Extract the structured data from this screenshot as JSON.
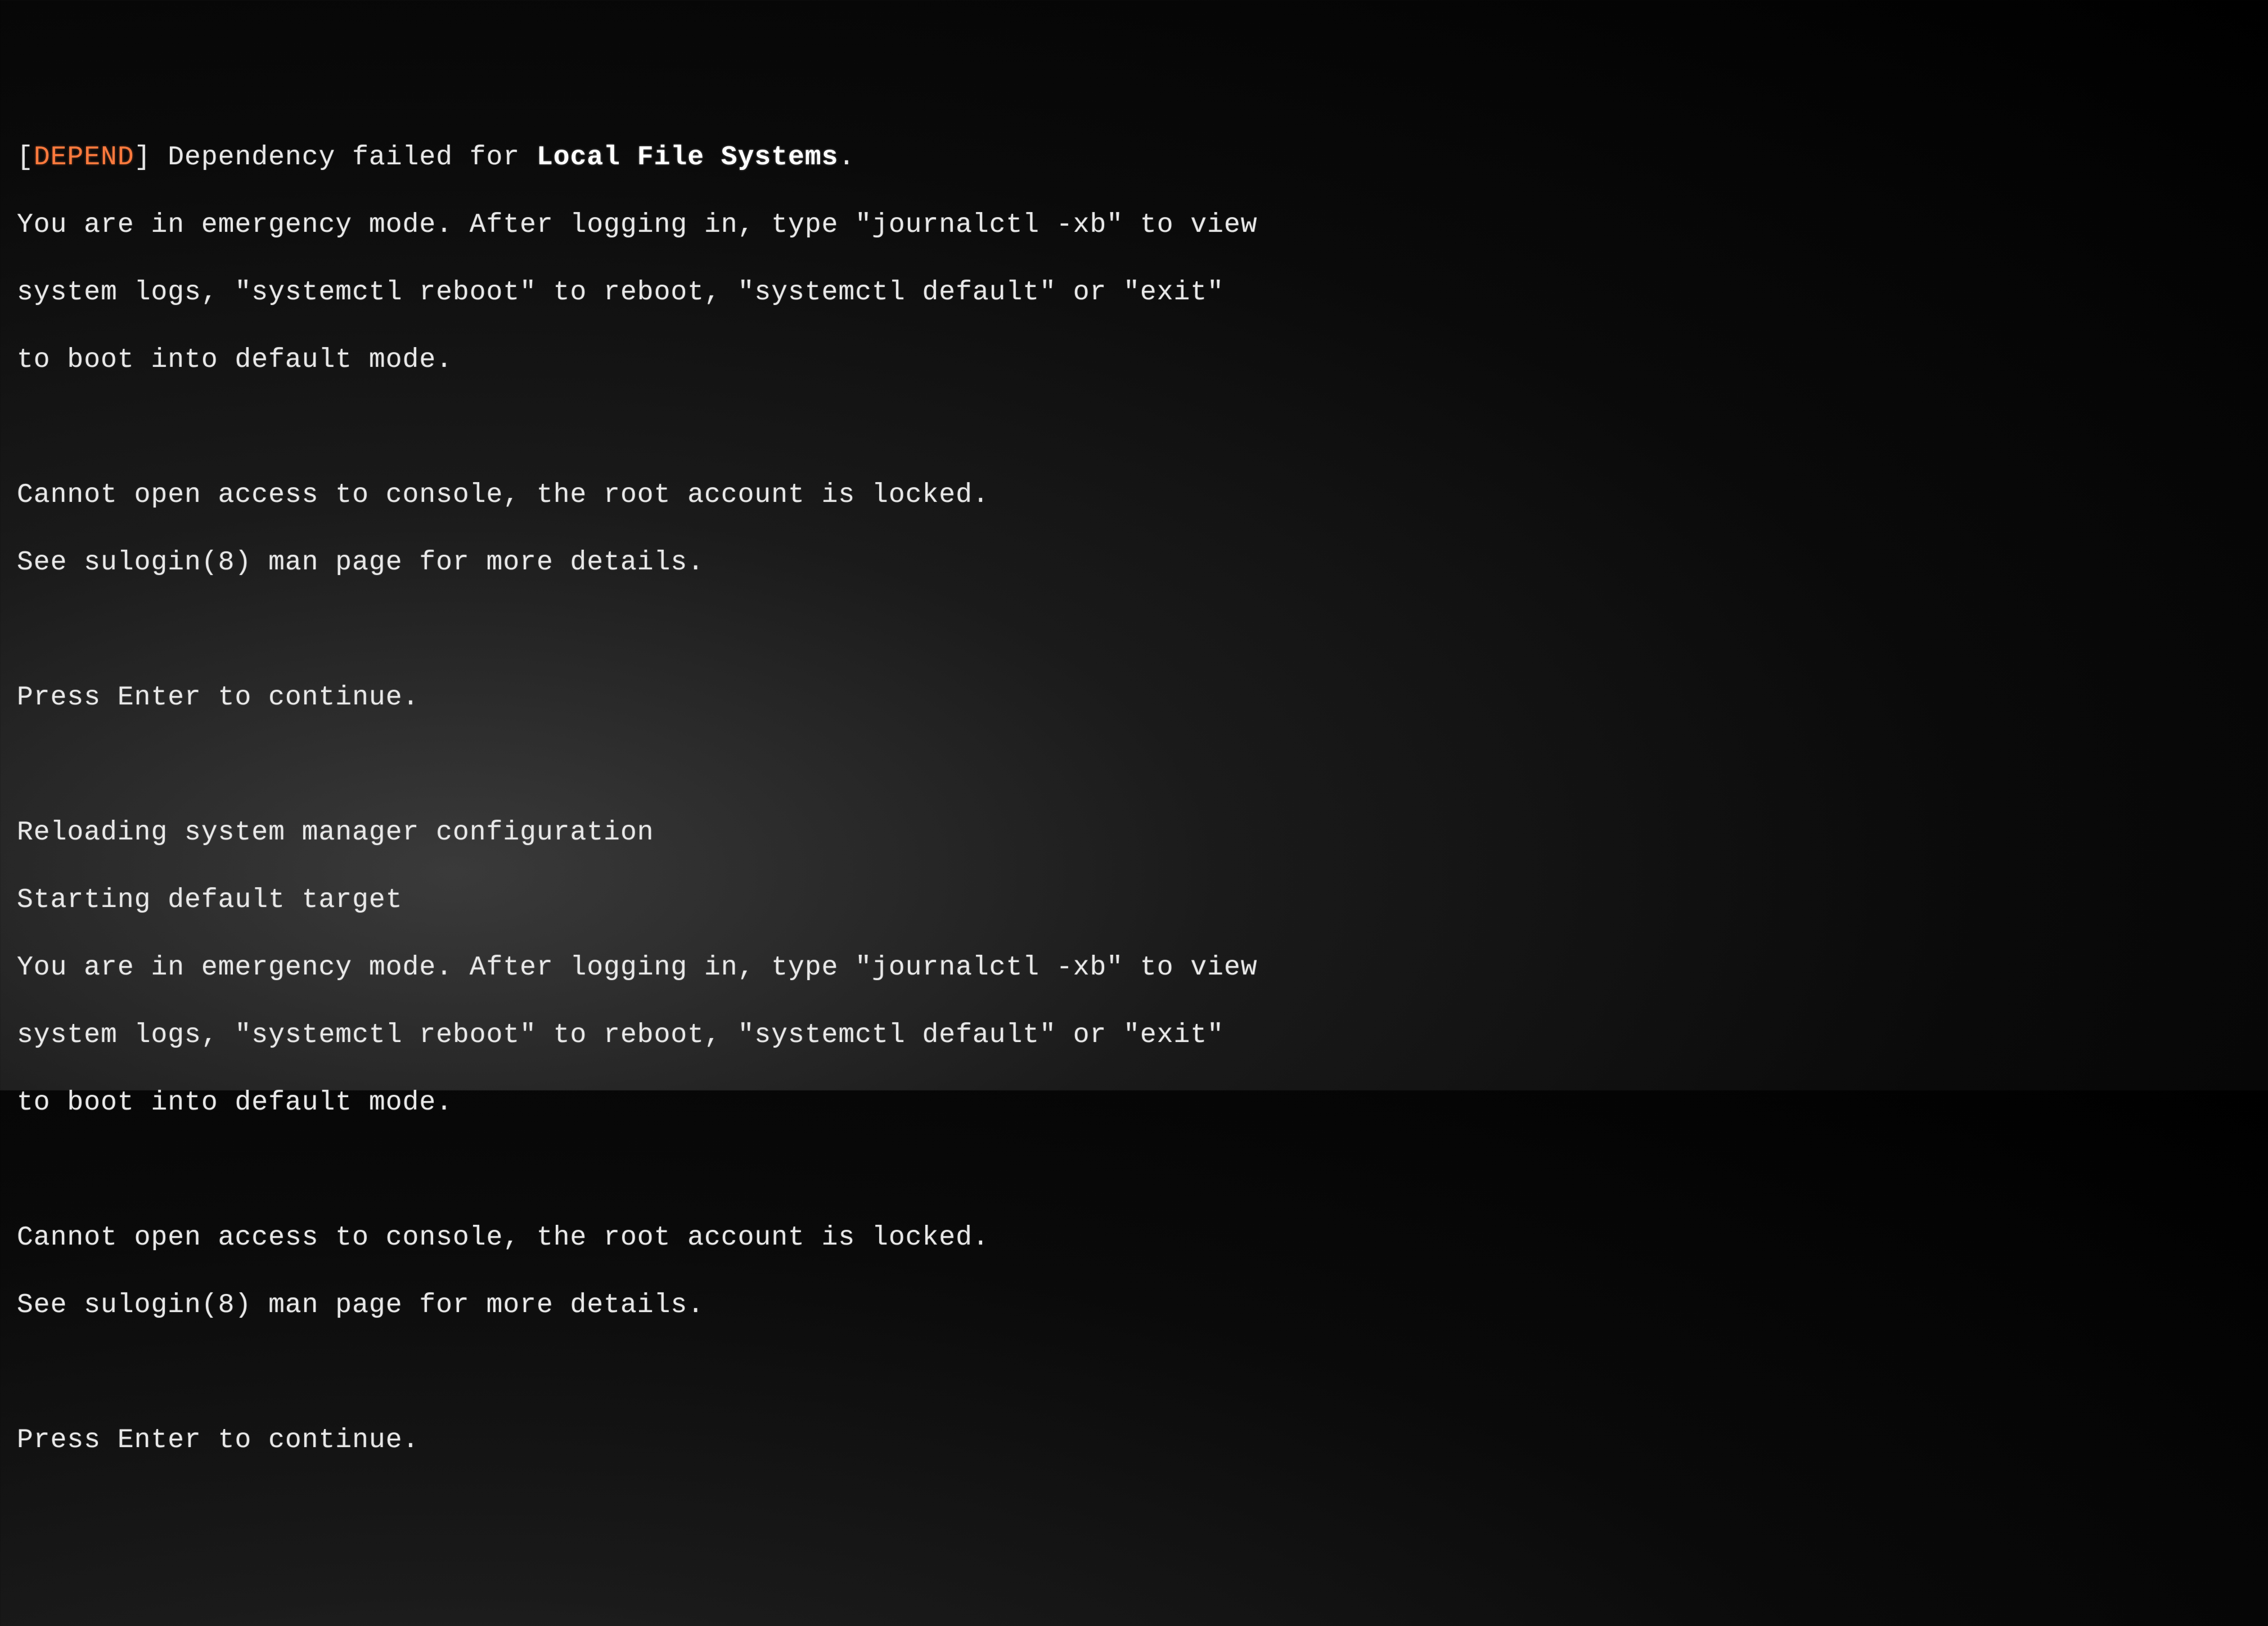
{
  "colors": {
    "depend_tag": "#ff7a3d",
    "text": "#e8e8e8",
    "bold": "#ffffff",
    "background": "#000000"
  },
  "lines": {
    "l0_pre": "[",
    "l0_tag": "DEPEND",
    "l0_mid": "] Dependency failed for ",
    "l0_bold": "Local File Systems",
    "l0_post": ".",
    "l1": "You are in emergency mode. After logging in, type \"journalctl -xb\" to view",
    "l2": "system logs, \"systemctl reboot\" to reboot, \"systemctl default\" or \"exit\"",
    "l3": "to boot into default mode.",
    "l4": "Cannot open access to console, the root account is locked.",
    "l5": "See sulogin(8) man page for more details.",
    "l6": "Press Enter to continue.",
    "l7": "Reloading system manager configuration",
    "l8": "Starting default target",
    "l9": "You are in emergency mode. After logging in, type \"journalctl -xb\" to view",
    "l10": "system logs, \"systemctl reboot\" to reboot, \"systemctl default\" or \"exit\"",
    "l11": "to boot into default mode.",
    "l12": "Cannot open access to console, the root account is locked.",
    "l13": "See sulogin(8) man page for more details.",
    "l14": "Press Enter to continue."
  }
}
